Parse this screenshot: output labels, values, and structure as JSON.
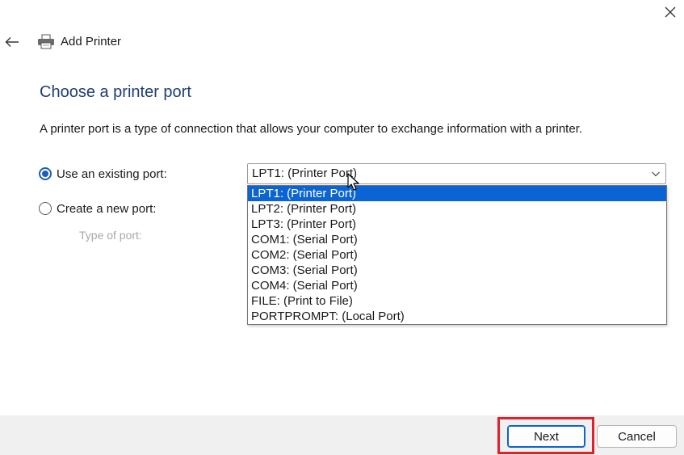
{
  "window": {
    "close_icon": "close-icon"
  },
  "nav": {
    "back_icon": "back-arrow-icon",
    "printer_icon": "printer-icon",
    "title": "Add Printer"
  },
  "page": {
    "heading": "Choose a printer port",
    "description": "A printer port is a type of connection that allows your computer to exchange information with a printer."
  },
  "options": {
    "existing_port_label": "Use an existing port:",
    "existing_port_checked": true,
    "new_port_label": "Create a new port:",
    "new_port_checked": false,
    "port_type_label": "Type of port:"
  },
  "port_select": {
    "value": "LPT1: (Printer Port)",
    "options": [
      "LPT1: (Printer Port)",
      "LPT2: (Printer Port)",
      "LPT3: (Printer Port)",
      "COM1: (Serial Port)",
      "COM2: (Serial Port)",
      "COM3: (Serial Port)",
      "COM4: (Serial Port)",
      "FILE: (Print to File)",
      "PORTPROMPT: (Local Port)"
    ],
    "highlighted_index": 0
  },
  "footer": {
    "next_label": "Next",
    "cancel_label": "Cancel"
  },
  "colors": {
    "heading": "#1f3c78",
    "accent": "#0a64d4",
    "highlight_box": "#e0202a"
  }
}
